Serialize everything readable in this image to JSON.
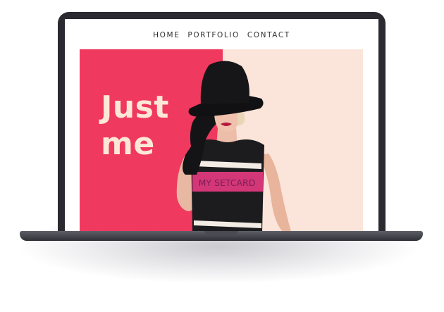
{
  "nav": {
    "items": [
      "HOME",
      "PORTFOLIO",
      "CONTACT"
    ]
  },
  "hero": {
    "title": "Just\nme",
    "shirt_text": "MY SETCARD",
    "colors": {
      "left_panel": "#f0395f",
      "right_panel": "#fbe4d9",
      "title": "#fde8d8"
    }
  }
}
